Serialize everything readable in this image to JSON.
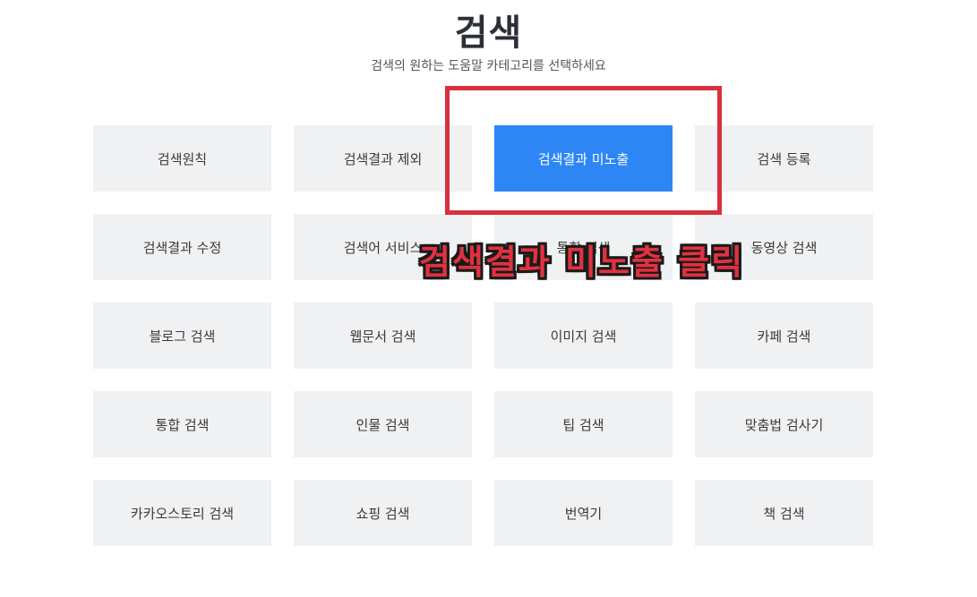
{
  "header": {
    "title": "검색",
    "subtitle": "검색의 원하는 도움말 카테고리를 선택하세요"
  },
  "categories": [
    {
      "label": "검색원칙"
    },
    {
      "label": "검색결과 제외"
    },
    {
      "label": "검색결과 미노출",
      "active": true
    },
    {
      "label": "검색 등록"
    },
    {
      "label": "검색결과 수정"
    },
    {
      "label": "검색어 서비스"
    },
    {
      "label": "통합 검색"
    },
    {
      "label": "동영상 검색"
    },
    {
      "label": "블로그 검색"
    },
    {
      "label": "웹문서 검색"
    },
    {
      "label": "이미지 검색"
    },
    {
      "label": "카페 검색"
    },
    {
      "label": "통합 검색"
    },
    {
      "label": "인물 검색"
    },
    {
      "label": "팁 검색"
    },
    {
      "label": "맞춤법 검사기"
    },
    {
      "label": "카카오스토리 검색"
    },
    {
      "label": "쇼핑 검색"
    },
    {
      "label": "번역기"
    },
    {
      "label": "책 검색"
    }
  ],
  "annotation": {
    "text": "검색결과 미노출 클릭"
  },
  "colors": {
    "active": "#2e86f5",
    "tile": "#f0f1f3",
    "highlight": "#d7303e"
  }
}
